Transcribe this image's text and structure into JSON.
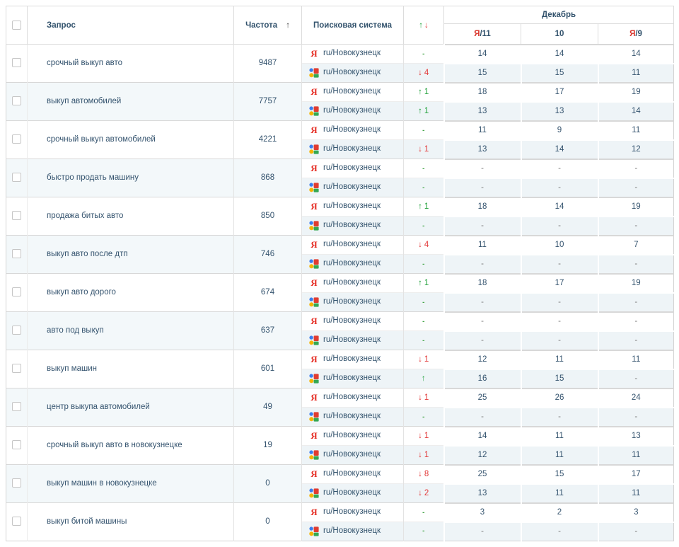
{
  "header": {
    "query": "Запрос",
    "frequency": "Частота",
    "sort_arrow": "↑",
    "search_system": "Поисковая система",
    "change_up": "↑",
    "change_down": "↓",
    "month": "Декабрь",
    "date_cols": [
      {
        "prefix": "Я",
        "label": "/11"
      },
      {
        "prefix": "",
        "label": "10"
      },
      {
        "prefix": "Я",
        "label": "/9"
      }
    ]
  },
  "glyphs": {
    "up": "↑",
    "down": "↓",
    "dash": "-"
  },
  "engine_label": "ru/Новокузнецк",
  "colors": {
    "pink": "#f8dcdd",
    "pink_deep": "#f6cccd",
    "gray": "#dcdcdc",
    "teal": "#dfeae9",
    "green_bright": "#79e4a1",
    "green_bright2": "#65dd94",
    "green_light": "#cbe9cf",
    "green_pale": "#e4f1e6",
    "beige": "#ecebe7",
    "row_google": "#eef4f7",
    "row_alt": "#f3f8fa",
    "accent_red": "#e23a3a",
    "accent_green": "#22a23c",
    "yandex_red": "#e52d24",
    "text": "#34536e"
  },
  "rows": [
    {
      "query": "срочный выкуп авто",
      "frequency": "9487",
      "engines": [
        {
          "type": "yandex",
          "change": {
            "dir": "none",
            "value": ""
          },
          "positions": [
            {
              "v": "14",
              "c": "pink"
            },
            {
              "v": "14",
              "c": "pink"
            },
            {
              "v": "14",
              "c": "pink"
            }
          ]
        },
        {
          "type": "google",
          "change": {
            "dir": "down",
            "value": "4"
          },
          "positions": [
            {
              "v": "15",
              "c": "gray"
            },
            {
              "v": "15",
              "c": "gray"
            },
            {
              "v": "11",
              "c": "teal"
            }
          ]
        }
      ]
    },
    {
      "query": "выкуп автомобилей",
      "frequency": "7757",
      "engines": [
        {
          "type": "yandex",
          "change": {
            "dir": "up",
            "value": "1"
          },
          "positions": [
            {
              "v": "18",
              "c": "pink"
            },
            {
              "v": "17",
              "c": "pink"
            },
            {
              "v": "19",
              "c": "pink"
            }
          ]
        },
        {
          "type": "google",
          "change": {
            "dir": "up",
            "value": "1"
          },
          "positions": [
            {
              "v": "13",
              "c": "teal"
            },
            {
              "v": "13",
              "c": "teal"
            },
            {
              "v": "14",
              "c": "teal"
            }
          ]
        }
      ]
    },
    {
      "query": "срочный выкуп автомобилей",
      "frequency": "4221",
      "engines": [
        {
          "type": "yandex",
          "change": {
            "dir": "none",
            "value": ""
          },
          "positions": [
            {
              "v": "11",
              "c": "pink"
            },
            {
              "v": "9",
              "c": "gpale"
            },
            {
              "v": "11",
              "c": "pink"
            }
          ]
        },
        {
          "type": "google",
          "change": {
            "dir": "down",
            "value": "1"
          },
          "positions": [
            {
              "v": "13",
              "c": "teal"
            },
            {
              "v": "14",
              "c": "teal"
            },
            {
              "v": "12",
              "c": "teal"
            }
          ]
        }
      ]
    },
    {
      "query": "быстро продать машину",
      "frequency": "868",
      "engines": [
        {
          "type": "yandex",
          "change": {
            "dir": "none",
            "value": ""
          },
          "positions": [
            {
              "v": "-",
              "c": ""
            },
            {
              "v": "-",
              "c": ""
            },
            {
              "v": "-",
              "c": ""
            }
          ]
        },
        {
          "type": "google",
          "change": {
            "dir": "none",
            "value": ""
          },
          "positions": [
            {
              "v": "-",
              "c": ""
            },
            {
              "v": "-",
              "c": ""
            },
            {
              "v": "-",
              "c": ""
            }
          ]
        }
      ]
    },
    {
      "query": "продажа битых авто",
      "frequency": "850",
      "engines": [
        {
          "type": "yandex",
          "change": {
            "dir": "up",
            "value": "1"
          },
          "positions": [
            {
              "v": "18",
              "c": "pink"
            },
            {
              "v": "14",
              "c": "pink"
            },
            {
              "v": "19",
              "c": "pink"
            }
          ]
        },
        {
          "type": "google",
          "change": {
            "dir": "none",
            "value": ""
          },
          "positions": [
            {
              "v": "-",
              "c": ""
            },
            {
              "v": "-",
              "c": ""
            },
            {
              "v": "-",
              "c": ""
            }
          ]
        }
      ]
    },
    {
      "query": "выкуп авто после дтп",
      "frequency": "746",
      "engines": [
        {
          "type": "yandex",
          "change": {
            "dir": "down",
            "value": "4"
          },
          "positions": [
            {
              "v": "11",
              "c": "pink"
            },
            {
              "v": "10",
              "c": "beige"
            },
            {
              "v": "7",
              "c": "glight"
            }
          ]
        },
        {
          "type": "google",
          "change": {
            "dir": "none",
            "value": ""
          },
          "positions": [
            {
              "v": "-",
              "c": ""
            },
            {
              "v": "-",
              "c": ""
            },
            {
              "v": "-",
              "c": ""
            }
          ]
        }
      ]
    },
    {
      "query": "выкуп авто дорого",
      "frequency": "674",
      "engines": [
        {
          "type": "yandex",
          "change": {
            "dir": "up",
            "value": "1"
          },
          "positions": [
            {
              "v": "18",
              "c": "pink"
            },
            {
              "v": "17",
              "c": "pink"
            },
            {
              "v": "19",
              "c": "pink"
            }
          ]
        },
        {
          "type": "google",
          "change": {
            "dir": "none",
            "value": ""
          },
          "positions": [
            {
              "v": "-",
              "c": ""
            },
            {
              "v": "-",
              "c": ""
            },
            {
              "v": "-",
              "c": ""
            }
          ]
        }
      ]
    },
    {
      "query": "авто под выкуп",
      "frequency": "637",
      "engines": [
        {
          "type": "yandex",
          "change": {
            "dir": "none",
            "value": ""
          },
          "positions": [
            {
              "v": "-",
              "c": ""
            },
            {
              "v": "-",
              "c": ""
            },
            {
              "v": "-",
              "c": ""
            }
          ]
        },
        {
          "type": "google",
          "change": {
            "dir": "none",
            "value": ""
          },
          "positions": [
            {
              "v": "-",
              "c": ""
            },
            {
              "v": "-",
              "c": ""
            },
            {
              "v": "-",
              "c": ""
            }
          ]
        }
      ]
    },
    {
      "query": "выкуп машин",
      "frequency": "601",
      "engines": [
        {
          "type": "yandex",
          "change": {
            "dir": "down",
            "value": "1"
          },
          "positions": [
            {
              "v": "12",
              "c": "pink"
            },
            {
              "v": "11",
              "c": "pink"
            },
            {
              "v": "11",
              "c": "pink"
            }
          ]
        },
        {
          "type": "google",
          "change": {
            "dir": "up",
            "value": ""
          },
          "positions": [
            {
              "v": "16",
              "c": "gray"
            },
            {
              "v": "15",
              "c": "gray"
            },
            {
              "v": "-",
              "c": ""
            }
          ]
        }
      ]
    },
    {
      "query": "центр выкупа автомобилей",
      "frequency": "49",
      "engines": [
        {
          "type": "yandex",
          "change": {
            "dir": "down",
            "value": "1"
          },
          "positions": [
            {
              "v": "25",
              "c": "pink2"
            },
            {
              "v": "26",
              "c": "pink2"
            },
            {
              "v": "24",
              "c": "pink2"
            }
          ]
        },
        {
          "type": "google",
          "change": {
            "dir": "none",
            "value": ""
          },
          "positions": [
            {
              "v": "-",
              "c": ""
            },
            {
              "v": "-",
              "c": ""
            },
            {
              "v": "-",
              "c": ""
            }
          ]
        }
      ]
    },
    {
      "query": "срочный выкуп авто в новокузнецке",
      "frequency": "19",
      "engines": [
        {
          "type": "yandex",
          "change": {
            "dir": "down",
            "value": "1"
          },
          "positions": [
            {
              "v": "14",
              "c": "pink"
            },
            {
              "v": "11",
              "c": "pink"
            },
            {
              "v": "13",
              "c": "pink"
            }
          ]
        },
        {
          "type": "google",
          "change": {
            "dir": "down",
            "value": "1"
          },
          "positions": [
            {
              "v": "12",
              "c": "teal"
            },
            {
              "v": "11",
              "c": "teal"
            },
            {
              "v": "11",
              "c": "teal"
            }
          ]
        }
      ]
    },
    {
      "query": "выкуп машин в новокузнецке",
      "frequency": "0",
      "engines": [
        {
          "type": "yandex",
          "change": {
            "dir": "down",
            "value": "8"
          },
          "positions": [
            {
              "v": "25",
              "c": "pink2"
            },
            {
              "v": "15",
              "c": "pink"
            },
            {
              "v": "17",
              "c": "pink"
            }
          ]
        },
        {
          "type": "google",
          "change": {
            "dir": "down",
            "value": "2"
          },
          "positions": [
            {
              "v": "13",
              "c": "teal"
            },
            {
              "v": "11",
              "c": "teal"
            },
            {
              "v": "11",
              "c": "teal"
            }
          ]
        }
      ]
    },
    {
      "query": "выкуп битой машины",
      "frequency": "0",
      "engines": [
        {
          "type": "yandex",
          "change": {
            "dir": "none",
            "value": ""
          },
          "positions": [
            {
              "v": "3",
              "c": "green"
            },
            {
              "v": "2",
              "c": "green2"
            },
            {
              "v": "3",
              "c": "green"
            }
          ]
        },
        {
          "type": "google",
          "change": {
            "dir": "none",
            "value": ""
          },
          "positions": [
            {
              "v": "-",
              "c": ""
            },
            {
              "v": "-",
              "c": ""
            },
            {
              "v": "-",
              "c": ""
            }
          ]
        }
      ]
    }
  ]
}
